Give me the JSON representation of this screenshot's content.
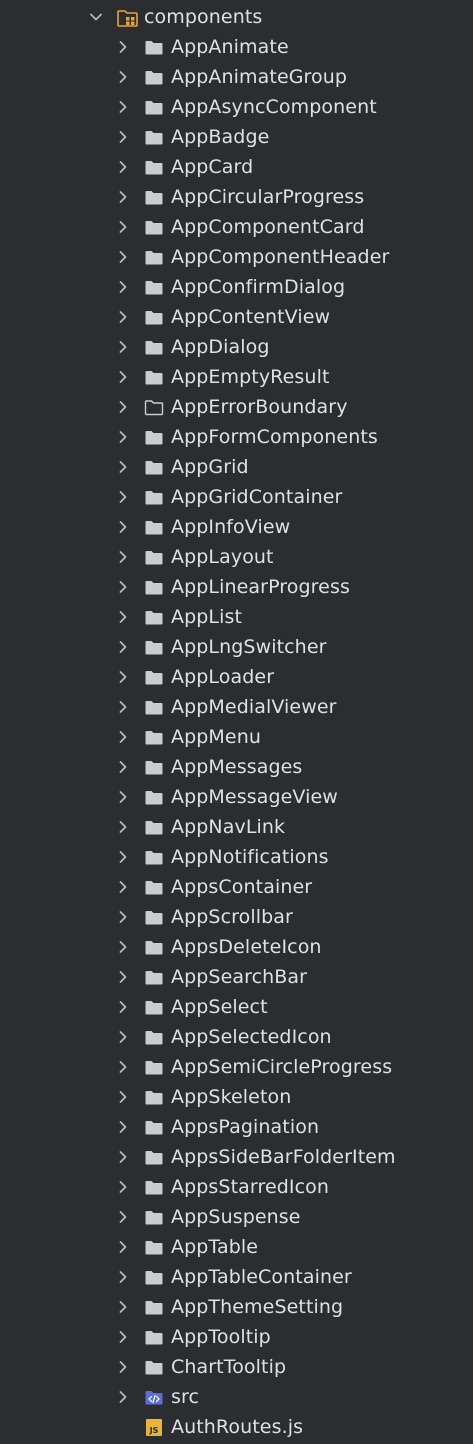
{
  "root": {
    "label": "components",
    "icon": "module-folder-icon",
    "expanded": true
  },
  "items": [
    {
      "label": "AppAnimate",
      "icon": "folder-icon"
    },
    {
      "label": "AppAnimateGroup",
      "icon": "folder-icon"
    },
    {
      "label": "AppAsyncComponent",
      "icon": "folder-icon"
    },
    {
      "label": "AppBadge",
      "icon": "folder-icon"
    },
    {
      "label": "AppCard",
      "icon": "folder-icon"
    },
    {
      "label": "AppCircularProgress",
      "icon": "folder-icon"
    },
    {
      "label": "AppComponentCard",
      "icon": "folder-icon"
    },
    {
      "label": "AppComponentHeader",
      "icon": "folder-icon"
    },
    {
      "label": "AppConfirmDialog",
      "icon": "folder-icon"
    },
    {
      "label": "AppContentView",
      "icon": "folder-icon"
    },
    {
      "label": "AppDialog",
      "icon": "folder-icon"
    },
    {
      "label": "AppEmptyResult",
      "icon": "folder-icon"
    },
    {
      "label": "AppErrorBoundary",
      "icon": "folder-outline-icon"
    },
    {
      "label": "AppFormComponents",
      "icon": "folder-icon"
    },
    {
      "label": "AppGrid",
      "icon": "folder-icon"
    },
    {
      "label": "AppGridContainer",
      "icon": "folder-icon"
    },
    {
      "label": "AppInfoView",
      "icon": "folder-icon"
    },
    {
      "label": "AppLayout",
      "icon": "folder-icon"
    },
    {
      "label": "AppLinearProgress",
      "icon": "folder-icon"
    },
    {
      "label": "AppList",
      "icon": "folder-icon"
    },
    {
      "label": "AppLngSwitcher",
      "icon": "folder-icon"
    },
    {
      "label": "AppLoader",
      "icon": "folder-icon"
    },
    {
      "label": "AppMedialViewer",
      "icon": "folder-icon"
    },
    {
      "label": "AppMenu",
      "icon": "folder-icon"
    },
    {
      "label": "AppMessages",
      "icon": "folder-icon"
    },
    {
      "label": "AppMessageView",
      "icon": "folder-icon"
    },
    {
      "label": "AppNavLink",
      "icon": "folder-icon"
    },
    {
      "label": "AppNotifications",
      "icon": "folder-icon"
    },
    {
      "label": "AppsContainer",
      "icon": "folder-icon"
    },
    {
      "label": "AppScrollbar",
      "icon": "folder-icon"
    },
    {
      "label": "AppsDeleteIcon",
      "icon": "folder-icon"
    },
    {
      "label": "AppSearchBar",
      "icon": "folder-icon"
    },
    {
      "label": "AppSelect",
      "icon": "folder-icon"
    },
    {
      "label": "AppSelectedIcon",
      "icon": "folder-icon"
    },
    {
      "label": "AppSemiCircleProgress",
      "icon": "folder-icon"
    },
    {
      "label": "AppSkeleton",
      "icon": "folder-icon"
    },
    {
      "label": "AppsPagination",
      "icon": "folder-icon"
    },
    {
      "label": "AppsSideBarFolderItem",
      "icon": "folder-icon"
    },
    {
      "label": "AppsStarredIcon",
      "icon": "folder-icon"
    },
    {
      "label": "AppSuspense",
      "icon": "folder-icon"
    },
    {
      "label": "AppTable",
      "icon": "folder-icon"
    },
    {
      "label": "AppTableContainer",
      "icon": "folder-icon"
    },
    {
      "label": "AppThemeSetting",
      "icon": "folder-icon"
    },
    {
      "label": "AppTooltip",
      "icon": "folder-icon"
    },
    {
      "label": "ChartTooltip",
      "icon": "folder-icon"
    },
    {
      "label": "src",
      "icon": "source-folder-icon"
    },
    {
      "label": "AuthRoutes.js",
      "icon": "js-file-icon",
      "file": true
    }
  ],
  "colors": {
    "background": "#2b2d30",
    "text": "#dfe1e5",
    "chevron": "#b4b8bf",
    "folder": "#c9ccd1",
    "module_folder": "#e8a33b",
    "source_folder": "#5b6fd6",
    "js_badge": "#e8b53b"
  }
}
